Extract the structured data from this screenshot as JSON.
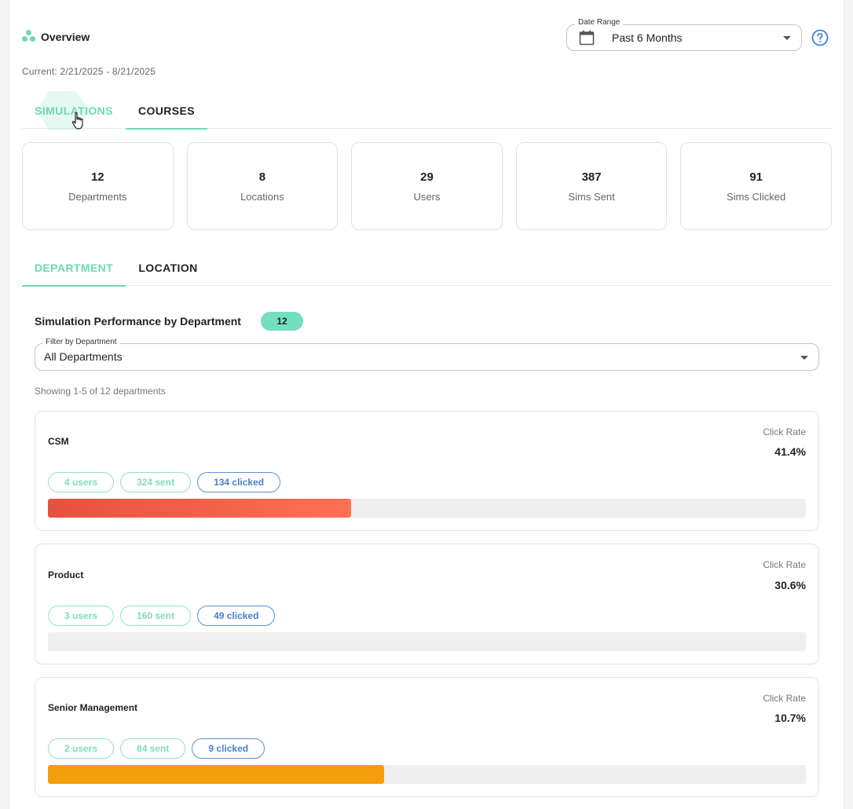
{
  "header": {
    "title": "Overview",
    "current_range": "Current: 2/21/2025 - 8/21/2025",
    "date_range": {
      "legend": "Date Range",
      "value": "Past 6 Months"
    }
  },
  "main_tabs": [
    {
      "label": "SIMULATIONS",
      "active": true
    },
    {
      "label": "COURSES",
      "active": false
    }
  ],
  "stats": [
    {
      "value": "12",
      "label": "Departments"
    },
    {
      "value": "8",
      "label": "Locations"
    },
    {
      "value": "29",
      "label": "Users"
    },
    {
      "value": "387",
      "label": "Sims Sent"
    },
    {
      "value": "91",
      "label": "Sims Clicked"
    }
  ],
  "sub_tabs": [
    {
      "label": "DEPARTMENT",
      "active": true
    },
    {
      "label": "LOCATION",
      "active": false
    }
  ],
  "section": {
    "title": "Simulation Performance by Department",
    "count": "12",
    "filter": {
      "legend": "Filter by Department",
      "value": "All Departments"
    },
    "showing": "Showing 1-5 of 12 departments"
  },
  "departments": [
    {
      "name": "CSM",
      "rate_label": "Click Rate",
      "rate": "41.4%",
      "users": "4 users",
      "sent": "324 sent",
      "clicked": "134 clicked",
      "bar_fill": 0.4,
      "bar_color_start": "#e8503f",
      "bar_color_end": "#ff6f55"
    },
    {
      "name": "Product",
      "rate_label": "Click Rate",
      "rate": "30.6%",
      "users": "3 users",
      "sent": "160 sent",
      "clicked": "49 clicked",
      "bar_fill": 0.0,
      "bar_color_start": "#efefef",
      "bar_color_end": "#efefef"
    },
    {
      "name": "Senior Management",
      "rate_label": "Click Rate",
      "rate": "10.7%",
      "users": "2 users",
      "sent": "84 sent",
      "clicked": "9 clicked",
      "bar_fill": 0.444,
      "bar_color_start": "#f59e0b",
      "bar_color_end": "#f59e0b"
    }
  ],
  "colors": {
    "accent": "#6fd8b8",
    "pill": "#74dfbe",
    "link_blue": "#4a7fd0"
  }
}
